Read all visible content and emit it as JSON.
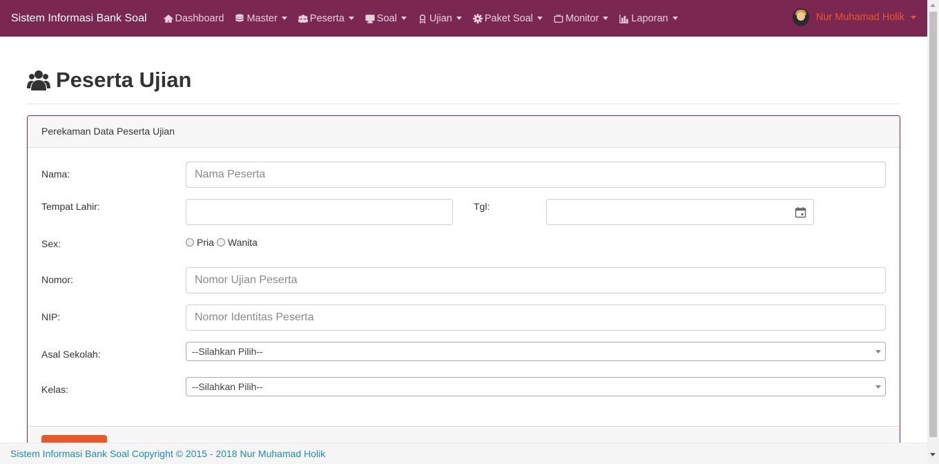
{
  "navbar": {
    "brand": "Sistem Informasi Bank Soal",
    "items": [
      {
        "label": "Dashboard",
        "icon": "home-icon",
        "has_caret": false
      },
      {
        "label": "Master",
        "icon": "database-icon",
        "has_caret": true
      },
      {
        "label": "Peserta",
        "icon": "users-icon",
        "has_caret": true
      },
      {
        "label": "Soal",
        "icon": "desktop-icon",
        "has_caret": true
      },
      {
        "label": "Ujian",
        "icon": "award-icon",
        "has_caret": true
      },
      {
        "label": "Paket Soal",
        "icon": "gear-icon",
        "has_caret": true
      },
      {
        "label": "Monitor",
        "icon": "tv-icon",
        "has_caret": true
      },
      {
        "label": "Laporan",
        "icon": "bar-chart-icon",
        "has_caret": true
      }
    ],
    "user_name": "Nur Muhamad Holik"
  },
  "page": {
    "title": "Peserta Ujian"
  },
  "card": {
    "header": "Perekaman Data Peserta Ujian",
    "fields": {
      "nama_label": "Nama:",
      "nama_placeholder": "Nama Peserta",
      "tempat_lahir_label": "Tempat Lahir:",
      "tgl_label": "Tgl:",
      "sex_label": "Sex:",
      "sex_options": [
        "Pria",
        "Wanita"
      ],
      "nomor_label": "Nomor:",
      "nomor_placeholder": "Nomor Ujian Peserta",
      "nip_label": "NIP:",
      "nip_placeholder": "Nomor Identitas Peserta",
      "asal_sekolah_label": "Asal Sekolah:",
      "asal_sekolah_value": "--Silahkan Pilih--",
      "kelas_label": "Kelas:",
      "kelas_value": "--Silahkan Pilih--"
    }
  },
  "footer": {
    "text": "Sistem Informasi Bank Soal Copyright © 2015 - 2018 Nur Muhamad Holik"
  },
  "colors": {
    "navbar": "#7a2752",
    "accent": "#e9572b",
    "footer_text": "#1e8bb5"
  }
}
